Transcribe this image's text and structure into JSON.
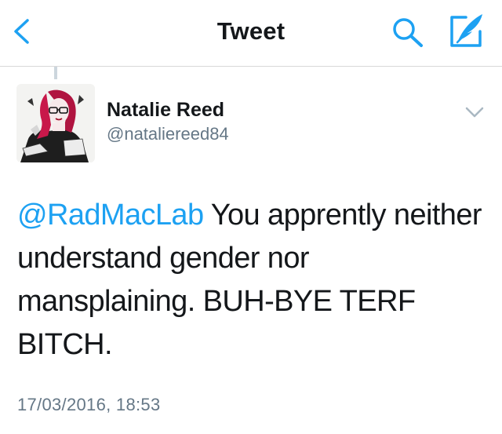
{
  "header": {
    "title": "Tweet",
    "icons": {
      "back": "chevron-left-icon",
      "search": "search-icon",
      "compose": "compose-quill-icon"
    },
    "accent_color": "#1da1f2"
  },
  "tweet": {
    "author": {
      "display_name": "Natalie Reed",
      "handle": "@nataliereed84"
    },
    "mention": "@RadMacLab",
    "text": " You apprently neither understand gender nor mansplaining. BUH-BYE TERF BITCH.",
    "timestamp": "17/03/2016, 18:53",
    "menu_icon": "chevron-down-icon"
  },
  "colors": {
    "text": "#14171a",
    "secondary": "#657786",
    "divider": "#d8d8d8",
    "link": "#1da1f2"
  }
}
